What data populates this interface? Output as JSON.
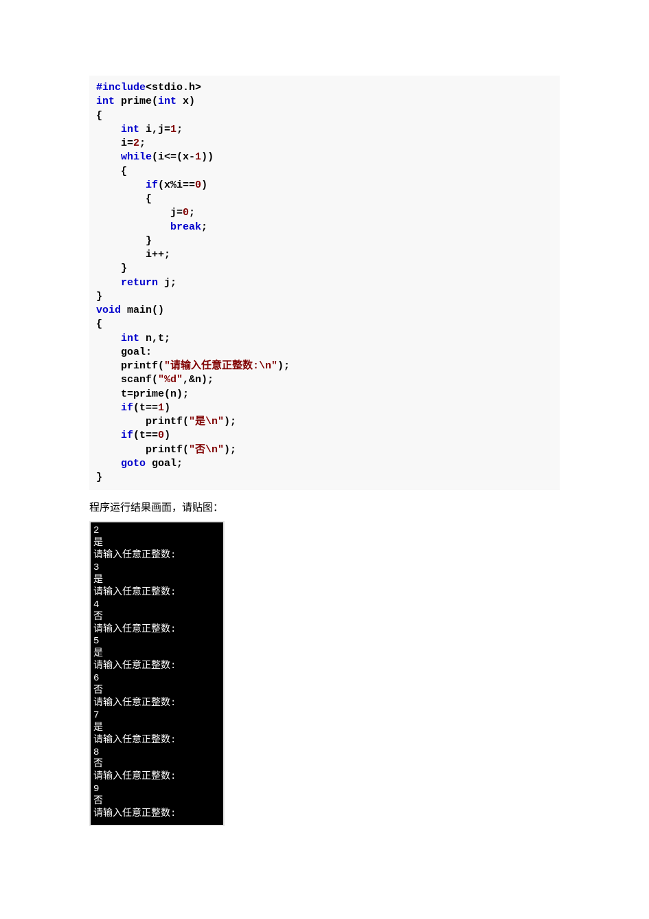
{
  "code": {
    "l1a": "#include",
    "l1b": "<stdio.h>",
    "l2a": "int",
    "l2b": " prime(",
    "l2c": "int",
    "l2d": " x)",
    "l3": "{",
    "l4a": "    ",
    "l4b": "int",
    "l4c": " i,j=",
    "l4d": "1",
    "l4e": ";",
    "l5a": "    i=",
    "l5b": "2",
    "l5c": ";",
    "l6a": "    ",
    "l6b": "while",
    "l6c": "(i<=(x-",
    "l6d": "1",
    "l6e": "))",
    "l7": "    {",
    "l8a": "        ",
    "l8b": "if",
    "l8c": "(x%i==",
    "l8d": "0",
    "l8e": ")",
    "l9": "        {",
    "l10a": "            j=",
    "l10b": "0",
    "l10c": ";",
    "l11a": "            ",
    "l11b": "break",
    "l11c": ";",
    "l12": "        }",
    "l13": "        i++;",
    "l14": "    }",
    "l15a": "    ",
    "l15b": "return",
    "l15c": " j;",
    "l16": "}",
    "l17a": "void",
    "l17b": " main()",
    "l18": "{",
    "l19a": "    ",
    "l19b": "int",
    "l19c": " n,t;",
    "l20": "    goal:",
    "l21a": "    printf(",
    "l21b": "\"请输入任意正整数:\\n\"",
    "l21c": ");",
    "l22a": "    scanf(",
    "l22b": "\"%d\"",
    "l22c": ",&n);",
    "l23": "    t=prime(n);",
    "l24a": "    ",
    "l24b": "if",
    "l24c": "(t==",
    "l24d": "1",
    "l24e": ")",
    "l25a": "        printf(",
    "l25b": "\"是\\n\"",
    "l25c": ");",
    "l26a": "    ",
    "l26b": "if",
    "l26c": "(t==",
    "l26d": "0",
    "l26e": ")",
    "l27a": "        printf(",
    "l27b": "\"否\\n\"",
    "l27c": ");",
    "l28a": "    ",
    "l28b": "goto",
    "l28c": " goal;",
    "l29": "}"
  },
  "caption": "程序运行结果画面，请贴图：",
  "console": "2\n是\n请输入任意正整数:\n3\n是\n请输入任意正整数:\n4\n否\n请输入任意正整数:\n5\n是\n请输入任意正整数:\n6\n否\n请输入任意正整数:\n7\n是\n请输入任意正整数:\n8\n否\n请输入任意正整数:\n9\n否\n请输入任意正整数:"
}
